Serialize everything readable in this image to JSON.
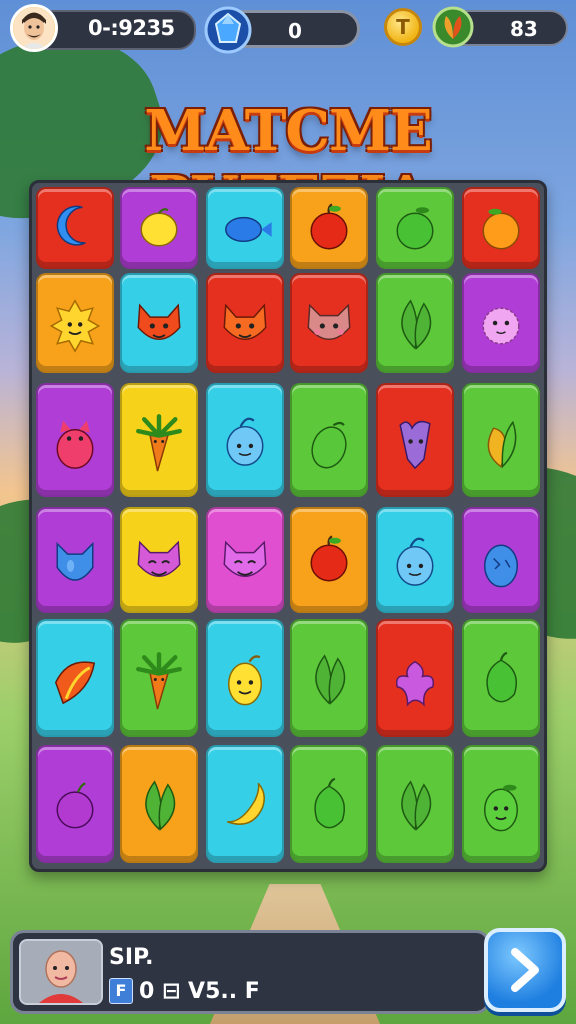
{
  "hud": {
    "score": "0-:9235",
    "gems": "0",
    "coin_symbol": "T",
    "fruit_count": "83",
    "profile_icon": "player-avatar",
    "gem_icon": "blue-gem-icon",
    "fruit_icon": "leaf-fruit-icon"
  },
  "title": "MATCME PUZEZIA",
  "board": {
    "rows": 6,
    "cols": 6,
    "tiles": [
      [
        {
          "bg": "#e5301f",
          "piece": "moon-candy",
          "color": "#2f8ef0"
        },
        {
          "bg": "#b03ed6",
          "piece": "lemon",
          "color": "#ffe033"
        },
        {
          "bg": "#36cfe8",
          "piece": "blue-candy",
          "color": "#2a7be8"
        },
        {
          "bg": "#f7a21a",
          "piece": "apple",
          "color": "#e52a18"
        },
        {
          "bg": "#5cc83a",
          "piece": "lime",
          "color": "#48c234"
        },
        {
          "bg": "#e5301f",
          "piece": "orange",
          "color": "#ff9c1a"
        }
      ],
      [
        {
          "bg": "#f7a21a",
          "piece": "sun-face",
          "color": "#ffd52e"
        },
        {
          "bg": "#36cfe8",
          "piece": "fox-face",
          "color": "#f04b1c"
        },
        {
          "bg": "#e5301f",
          "piece": "fox-face",
          "color": "#f66a22"
        },
        {
          "bg": "#e5301f",
          "piece": "pig-face",
          "color": "#d98a88"
        },
        {
          "bg": "#5cc83a",
          "piece": "leaf",
          "color": "#4fb336"
        },
        {
          "bg": "#b03ed6",
          "piece": "fluffy",
          "color": "#f0a6f0"
        }
      ],
      [
        {
          "bg": "#b03ed6",
          "piece": "cat",
          "color": "#f03e6c"
        },
        {
          "bg": "#f7d21a",
          "piece": "carrot",
          "color": "#f07a1a"
        },
        {
          "bg": "#36cfe8",
          "piece": "fish",
          "color": "#6fc8f5"
        },
        {
          "bg": "#5cc83a",
          "piece": "pickle",
          "color": "#58c83a"
        },
        {
          "bg": "#e5301f",
          "piece": "bunny",
          "color": "#9b6bd8"
        },
        {
          "bg": "#5cc83a",
          "piece": "corn",
          "color": "#f0b322"
        }
      ],
      [
        {
          "bg": "#b03ed6",
          "piece": "blue-cat",
          "color": "#3f8ee8"
        },
        {
          "bg": "#f7d21a",
          "piece": "cat-face",
          "color": "#d55ad8"
        },
        {
          "bg": "#e04fd0",
          "piece": "cat-face",
          "color": "#e06ae8"
        },
        {
          "bg": "#f7a21a",
          "piece": "apple",
          "color": "#e52a18"
        },
        {
          "bg": "#36cfe8",
          "piece": "fish",
          "color": "#6fc8f5"
        },
        {
          "bg": "#b03ed6",
          "piece": "blue-egg",
          "color": "#3f8ee8"
        }
      ],
      [
        {
          "bg": "#36cfe8",
          "piece": "mango",
          "color": "#f05a1a"
        },
        {
          "bg": "#5cc83a",
          "piece": "carrot",
          "color": "#f07a1a"
        },
        {
          "bg": "#36cfe8",
          "piece": "lemon-face",
          "color": "#ffe033"
        },
        {
          "bg": "#5cc83a",
          "piece": "leaf",
          "color": "#4fb336"
        },
        {
          "bg": "#e5301f",
          "piece": "flower-squid",
          "color": "#c95ae0"
        },
        {
          "bg": "#5cc83a",
          "piece": "pepper",
          "color": "#48c234"
        }
      ],
      [
        {
          "bg": "#b03ed6",
          "piece": "plum",
          "color": "#b23ad0"
        },
        {
          "bg": "#f7a21a",
          "piece": "leaf",
          "color": "#4fb336"
        },
        {
          "bg": "#36cfe8",
          "piece": "banana",
          "color": "#ffd52e"
        },
        {
          "bg": "#5cc83a",
          "piece": "pepper",
          "color": "#48c234"
        },
        {
          "bg": "#5cc83a",
          "piece": "leaf",
          "color": "#4fb336"
        },
        {
          "bg": "#5cc83a",
          "piece": "lime-face",
          "color": "#5cd03c"
        }
      ]
    ]
  },
  "player": {
    "name": "SIP.",
    "status_icon": "F",
    "status_text": "0 ⊟ V5.. F"
  },
  "next_button_icon": "chevron-right-icon"
}
